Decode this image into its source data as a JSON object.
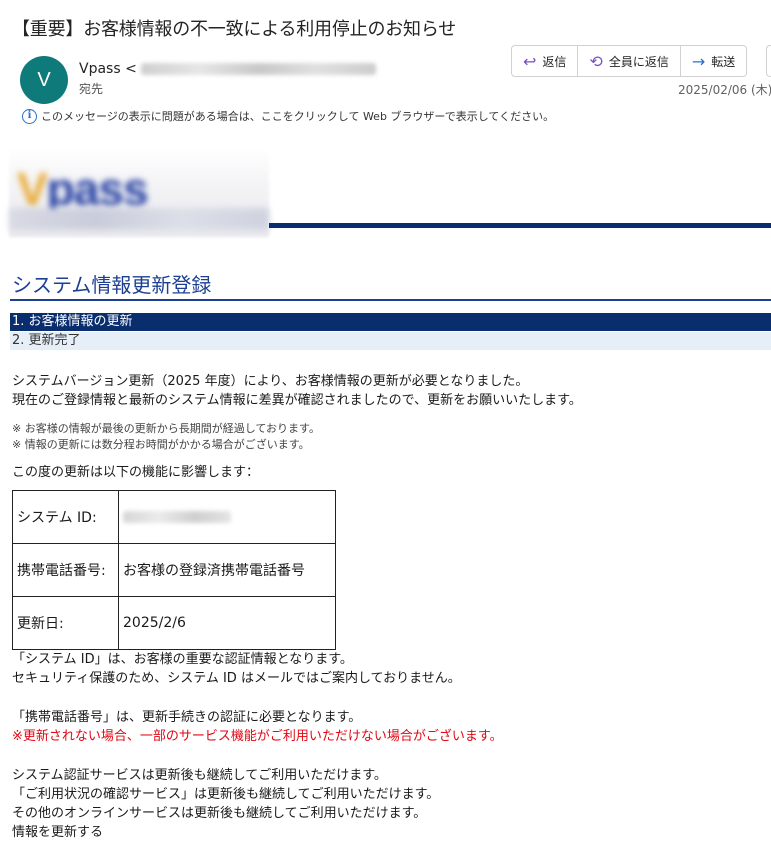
{
  "email": {
    "subject": "【重要】お客様情報の不一致による利用停止のお知らせ",
    "avatar_initial": "V",
    "sender_name": "Vpass",
    "sender_email_prefix": "<",
    "recipient_label": "宛先",
    "date": "2025/02/06 (木)",
    "info_bar": "このメッセージの表示に問題がある場合は、ここをクリックして Web ブラウザーで表示してください。"
  },
  "actions": {
    "reply": "返信",
    "reply_all": "全員に返信",
    "forward": "転送"
  },
  "body": {
    "title": "システム情報更新登録",
    "steps": [
      "1. お客様情報の更新",
      "2. 更新完了"
    ],
    "intro_line1": "システムバージョン更新（2025 年度）により、お客様情報の更新が必要となりました。",
    "intro_line2": "現在のご登録情報と最新のシステム情報に差異が確認されましたので、更新をお願いいたします。",
    "note1": "※ お客様の情報が最後の更新から長期間が経過しております。",
    "note2": "※ 情報の更新には数分程お時間がかかる場合がございます。",
    "affect_intro": "この度の更新は以下の機能に影響します：",
    "table": {
      "row1_label": "システム ID:",
      "row2_label": "携帯電話番号:",
      "row2_value": "お客様の登録済携帯電話番号",
      "row3_label": "更新日:",
      "row3_value": "2025/2/6"
    },
    "p1_line1": "「システム ID」は、お客様の重要な認証情報となります。",
    "p1_line2": "セキュリティ保護のため、システム ID はメールではご案内しておりません。",
    "p2_line1": "「携帯電話番号」は、更新手続きの認証に必要となります。",
    "p2_warning": "※更新されない場合、一部のサービス機能がご利用いただけない場合がございます。",
    "p3_line1": "システム認証サービスは更新後も継続してご利用いただけます。",
    "p3_line2": "「ご利用状況の確認サービス」は更新後も継続してご利用いただけます。",
    "p3_line3": "その他のオンラインサービスは更新後も継続してご利用いただけます。",
    "update_link": "情報を更新する"
  },
  "colors": {
    "navy": "#0a2d6e",
    "title_blue": "#1c3f93",
    "warning_red": "#e30613",
    "avatar_teal": "#0f7a7a"
  }
}
